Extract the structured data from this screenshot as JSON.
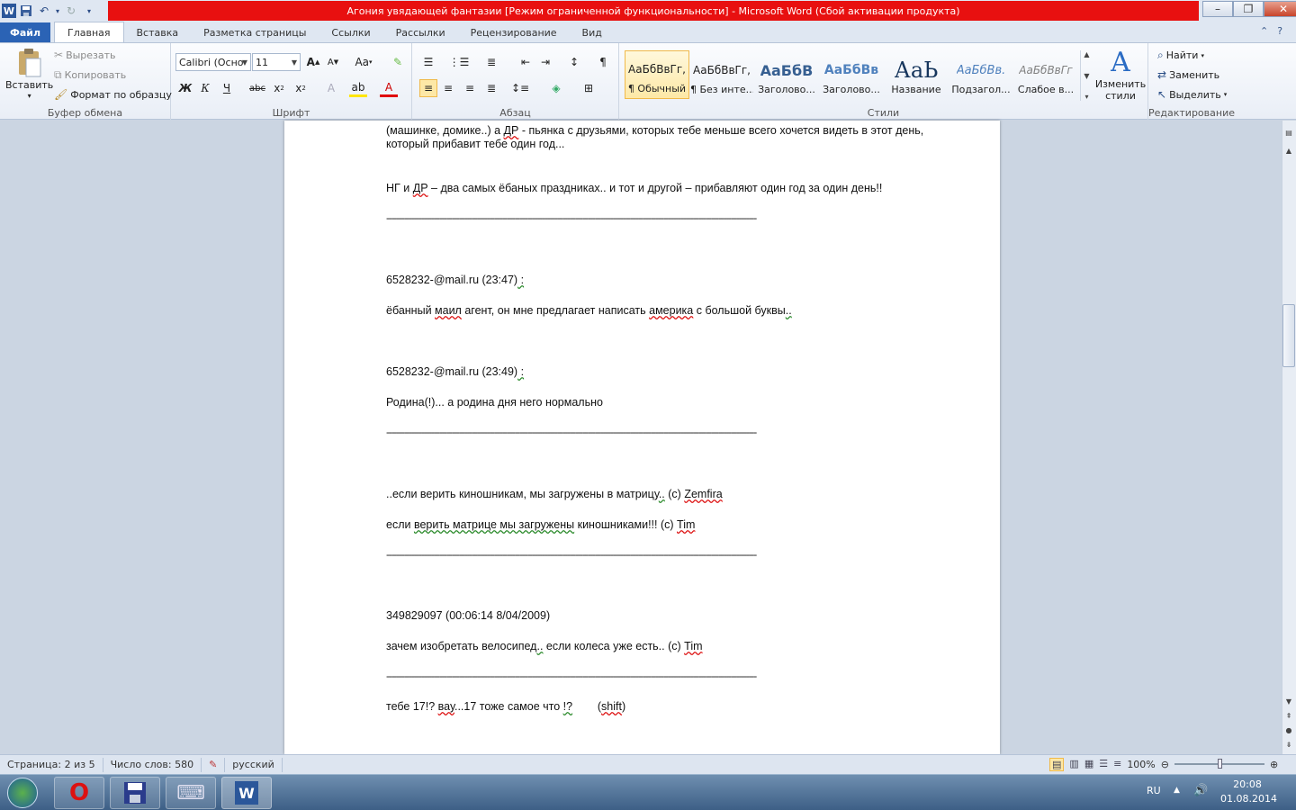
{
  "window": {
    "title": "Агония увядающей фантазии [Режим ограниченной функциональности]  -  Microsoft Word (Сбой активации продукта)"
  },
  "tabs": [
    "Файл",
    "Главная",
    "Вставка",
    "Разметка страницы",
    "Ссылки",
    "Рассылки",
    "Рецензирование",
    "Вид"
  ],
  "ribbon": {
    "clipboard": {
      "paste": "Вставить",
      "cut": "Вырезать",
      "copy": "Копировать",
      "format_painter": "Формат по образцу",
      "label": "Буфер обмена"
    },
    "font": {
      "name": "Calibri (Осно",
      "size": "11",
      "label": "Шрифт",
      "case_label": "Aa"
    },
    "paragraph": {
      "label": "Абзац"
    },
    "styles": {
      "label": "Стили",
      "items": [
        {
          "preview": "АаБбВвГг,",
          "name": "¶ Обычный"
        },
        {
          "preview": "АаБбВвГг,",
          "name": "¶ Без инте..."
        },
        {
          "preview": "АаБбВ",
          "name": "Заголово..."
        },
        {
          "preview": "АаБбВв",
          "name": "Заголово..."
        },
        {
          "preview": "АаЬ",
          "name": "Название"
        },
        {
          "preview": "АаБбВв.",
          "name": "Подзагол..."
        },
        {
          "preview": "АаБбВвГг",
          "name": "Слабое в..."
        }
      ],
      "change_styles": "Изменить стили"
    },
    "editing": {
      "find": "Найти",
      "replace": "Заменить",
      "select": "Выделить",
      "label": "Редактирование"
    }
  },
  "document": {
    "line1a": "(машинке, домике..) а ",
    "line1b": "ДР",
    "line1c": " - пьянка с друзьями, которых тебе меньше всего хочется видеть в этот день,",
    "line2": "который прибавит тебе один год...",
    "ng_a": "НГ и ",
    "ng_b": "ДР",
    "ng_c": " – два самых ёбаных праздниках.. и тот и другой – прибавляют один год за один день!!",
    "separator": "---------------------------------------------------------------------------------------------------------------------------------------------------",
    "msg1_head_a": "6528232-@mail.ru  (23:47)",
    "msg1_head_b": " :",
    "msg1_a": "ёбанный ",
    "msg1_b": "маил",
    "msg1_c": " агент, он мне предлагает написать ",
    "msg1_d": "америка",
    "msg1_e": " с большой буквы",
    "msg1_f": "..",
    "msg2_head_a": "6528232-@mail.ru  (23:49)",
    "msg2_head_b": " :",
    "msg2": "Родина(!)...  а родина дня него нормально",
    "quote1_a": "  ..если верить киношникам, мы загружены в матрицу",
    "quote1_b": "..",
    "quote1_c": " (c) ",
    "quote1_d": "Zemfira",
    "quote2_a": " если ",
    "quote2_b": "верить матрице мы загружены",
    "quote2_c": " киношниками!!! (c) ",
    "quote2_d": "Tim",
    "icq_head": " 349829097  (00:06:14  8/04/2009)",
    "bike_a": "зачем изобретать велосипед",
    "bike_b": "..",
    "bike_c": " если колеса уже есть.. (c) ",
    "bike_d": "Tim",
    "last_a": "тебе 17!? ",
    "last_b": "вау",
    "last_c": "...17  тоже самое что ",
    "last_d": "!?",
    "last_e": "        (",
    "last_f": "shift",
    "last_g": ")"
  },
  "status": {
    "page": "Страница: 2 из 5",
    "words": "Число слов: 580",
    "lang": "русский",
    "zoom": "100%"
  },
  "taskbar": {
    "lang": "RU",
    "time": "20:08",
    "date": "01.08.2014"
  },
  "colors": {
    "title_bar": "#e81010",
    "file_tab": "#2b63b5",
    "word_blue": "#2b579a"
  }
}
